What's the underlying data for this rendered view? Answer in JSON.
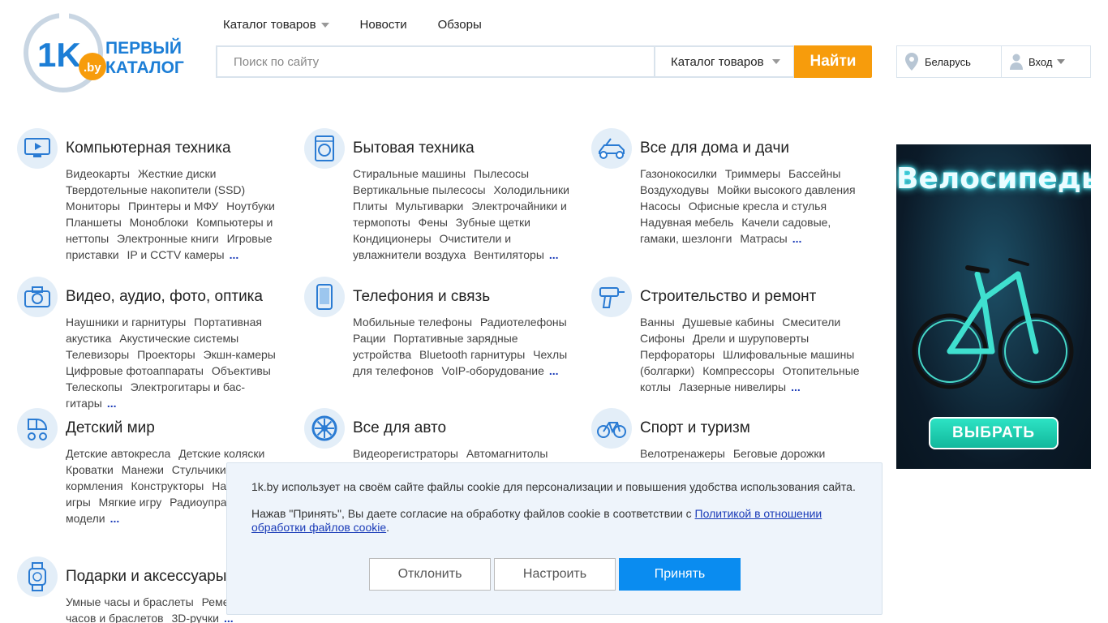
{
  "logo": {
    "number": "1K",
    "domain": ".by",
    "line1": "ПЕРВЫЙ",
    "line2": "КАТАЛОГ"
  },
  "nav": {
    "catalog": "Каталог товаров",
    "news": "Новости",
    "reviews": "Обзоры"
  },
  "search": {
    "placeholder": "Поиск по сайту",
    "category": "Каталог товаров",
    "button": "Найти"
  },
  "location": "Беларусь",
  "login": "Вход",
  "categories": [
    {
      "title": "Компьютерная техника",
      "links": [
        "Видеокарты",
        "Жесткие диски",
        "Твердотельные накопители (SSD)",
        "Мониторы",
        "Принтеры и МФУ",
        "Ноутбуки",
        "Планшеты",
        "Моноблоки",
        "Компьютеры и неттопы",
        "Электронные книги",
        "Игровые приставки",
        "IP и CCTV камеры"
      ]
    },
    {
      "title": "Бытовая техника",
      "links": [
        "Стиральные машины",
        "Пылесосы",
        "Вертикальные пылесосы",
        "Холодильники",
        "Плиты",
        "Мультиварки",
        "Электрочайники и термопоты",
        "Фены",
        "Зубные щетки",
        "Кондиционеры",
        "Очистители и увлажнители воздуха",
        "Вентиляторы"
      ]
    },
    {
      "title": "Все для дома и дачи",
      "links": [
        "Газонокосилки",
        "Триммеры",
        "Бассейны",
        "Воздуходувы",
        "Мойки высокого давления",
        "Насосы",
        "Офисные кресла и стулья",
        "Надувная мебель",
        "Качели садовые, гамаки, шезлонги",
        "Матрасы"
      ]
    },
    {
      "title": "Видео, аудио, фото, оптика",
      "links": [
        "Наушники и гарнитуры",
        "Портативная акустика",
        "Акустические системы",
        "Телевизоры",
        "Проекторы",
        "Экшн-камеры",
        "Цифровые фотоаппараты",
        "Объективы",
        "Телескопы",
        "Электрогитары и бас-гитары"
      ]
    },
    {
      "title": "Телефония и связь",
      "links": [
        "Мобильные телефоны",
        "Радиотелефоны",
        "Рации",
        "Портативные зарядные устройства",
        "Bluetooth гарнитуры",
        "Чехлы для телефонов",
        "VoIP-оборудование"
      ]
    },
    {
      "title": "Строительство и ремонт",
      "links": [
        "Ванны",
        "Душевые кабины",
        "Смесители",
        "Сифоны",
        "Дрели и шуруповерты",
        "Перфораторы",
        "Шлифовальные машины (болгарки)",
        "Компрессоры",
        "Отопительные котлы",
        "Лазерные нивелиры"
      ]
    },
    {
      "title": "Детский мир",
      "links": [
        "Детские автокресла",
        "Детские коляски",
        "Кроватки",
        "Манежи",
        "Стульчики для",
        "кормления",
        "Конструкторы",
        "На",
        "карточные игры",
        "Мягкие игру",
        "Радиоуправляемые модели"
      ]
    },
    {
      "title": "Все для авто",
      "links": [
        "Видеорегистраторы",
        "Автомагнитолы"
      ]
    },
    {
      "title": "Спорт и туризм",
      "links": [
        "Велотренажеры",
        "Беговые дорожки"
      ]
    },
    {
      "title": "Подарки и аксессуары",
      "links": [
        "Умные часы и браслеты",
        "Реме",
        "умных часов и браслетов",
        "3D-ручки"
      ]
    }
  ],
  "more_label": "...",
  "banner": {
    "title": "Велосипеды",
    "button": "ВЫБРАТЬ"
  },
  "cookie": {
    "text1": "1k.by использует на своём сайте файлы cookie для персонализации и повышения удобства использования сайта.",
    "text2_prefix": "Нажав \"Принять\", Вы даете согласие на обработку файлов cookie в соответствии с ",
    "text2_link": "Политикой в отношении обработки файлов cookie",
    "text2_suffix": ".",
    "decline": "Отклонить",
    "configure": "Настроить",
    "accept": "Принять"
  },
  "colors": {
    "accent": "#f79c0c",
    "primary": "#0a8cf0",
    "link": "#1a3bb8",
    "icon_bg": "#e3eef8"
  }
}
